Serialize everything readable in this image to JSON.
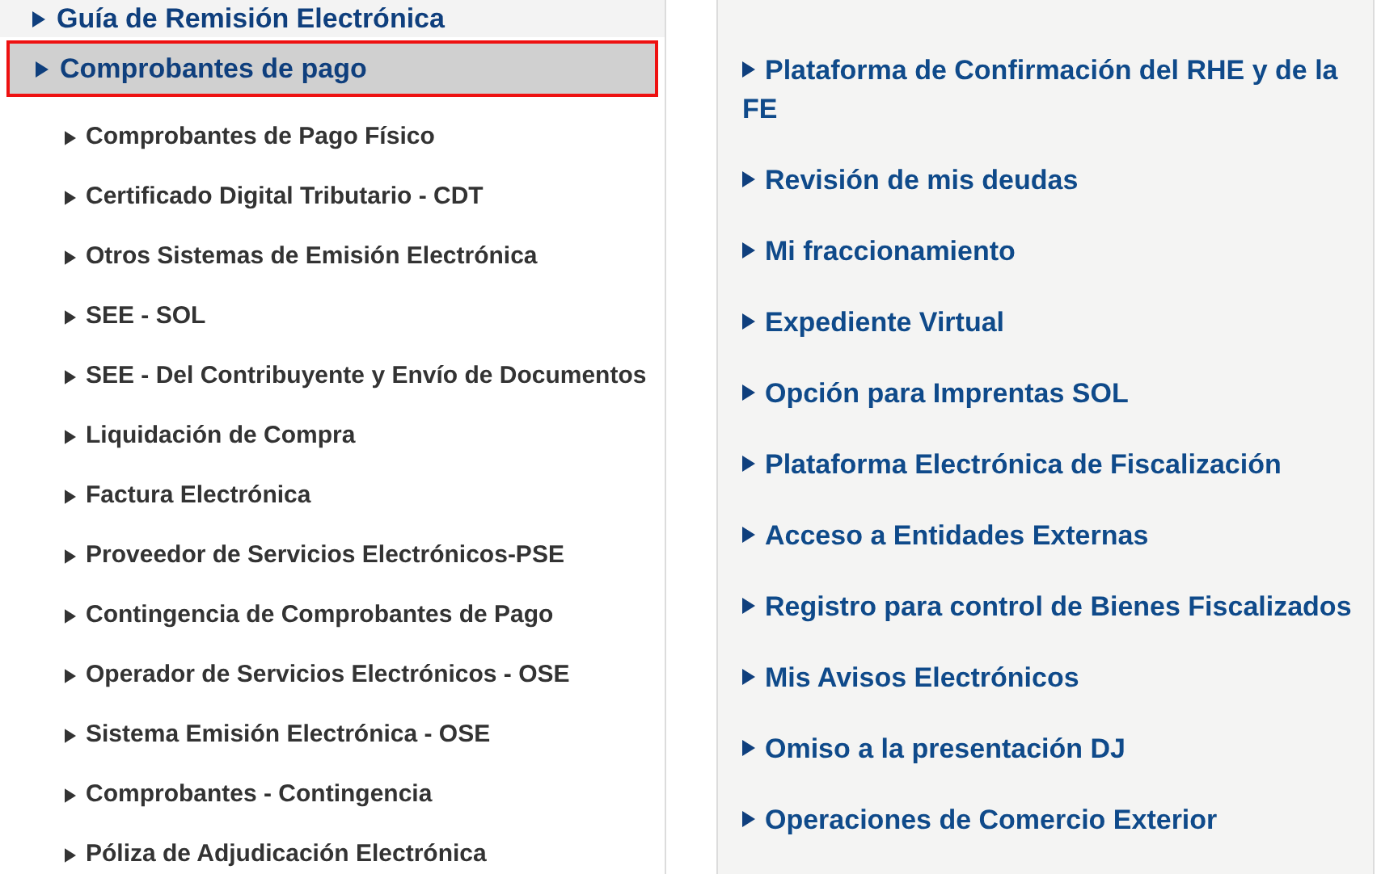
{
  "left_menu": {
    "items": [
      {
        "label": "Guía de Remisión Electrónica",
        "selected": false
      },
      {
        "label": "Comprobantes de pago",
        "selected": true,
        "children": [
          {
            "label": "Comprobantes de Pago Físico"
          },
          {
            "label": "Certificado Digital Tributario - CDT"
          },
          {
            "label": "Otros Sistemas de Emisión Electrónica"
          },
          {
            "label": "SEE - SOL"
          },
          {
            "label": "SEE - Del Contribuyente y Envío de Documentos"
          },
          {
            "label": "Liquidación de Compra"
          },
          {
            "label": "Factura Electrónica"
          },
          {
            "label": "Proveedor de Servicios Electrónicos-PSE"
          },
          {
            "label": "Contingencia de Comprobantes de Pago"
          },
          {
            "label": "Operador de Servicios Electrónicos - OSE"
          },
          {
            "label": "Sistema Emisión Electrónica - OSE"
          },
          {
            "label": "Comprobantes - Contingencia"
          },
          {
            "label": "Póliza de Adjudicación Electrónica"
          }
        ]
      }
    ]
  },
  "right_links": [
    {
      "label": "Plataforma de Confirmación del RHE y de la FE"
    },
    {
      "label": "Revisión de mis deudas"
    },
    {
      "label": "Mi fraccionamiento"
    },
    {
      "label": "Expediente Virtual"
    },
    {
      "label": "Opción para Imprentas SOL"
    },
    {
      "label": "Plataforma Electrónica de Fiscalización"
    },
    {
      "label": "Acceso a Entidades Externas"
    },
    {
      "label": "Registro para control de Bienes Fiscalizados"
    },
    {
      "label": "Mis Avisos Electrónicos"
    },
    {
      "label": "Omiso a la presentación DJ"
    },
    {
      "label": "Operaciones de Comercio Exterior"
    }
  ]
}
